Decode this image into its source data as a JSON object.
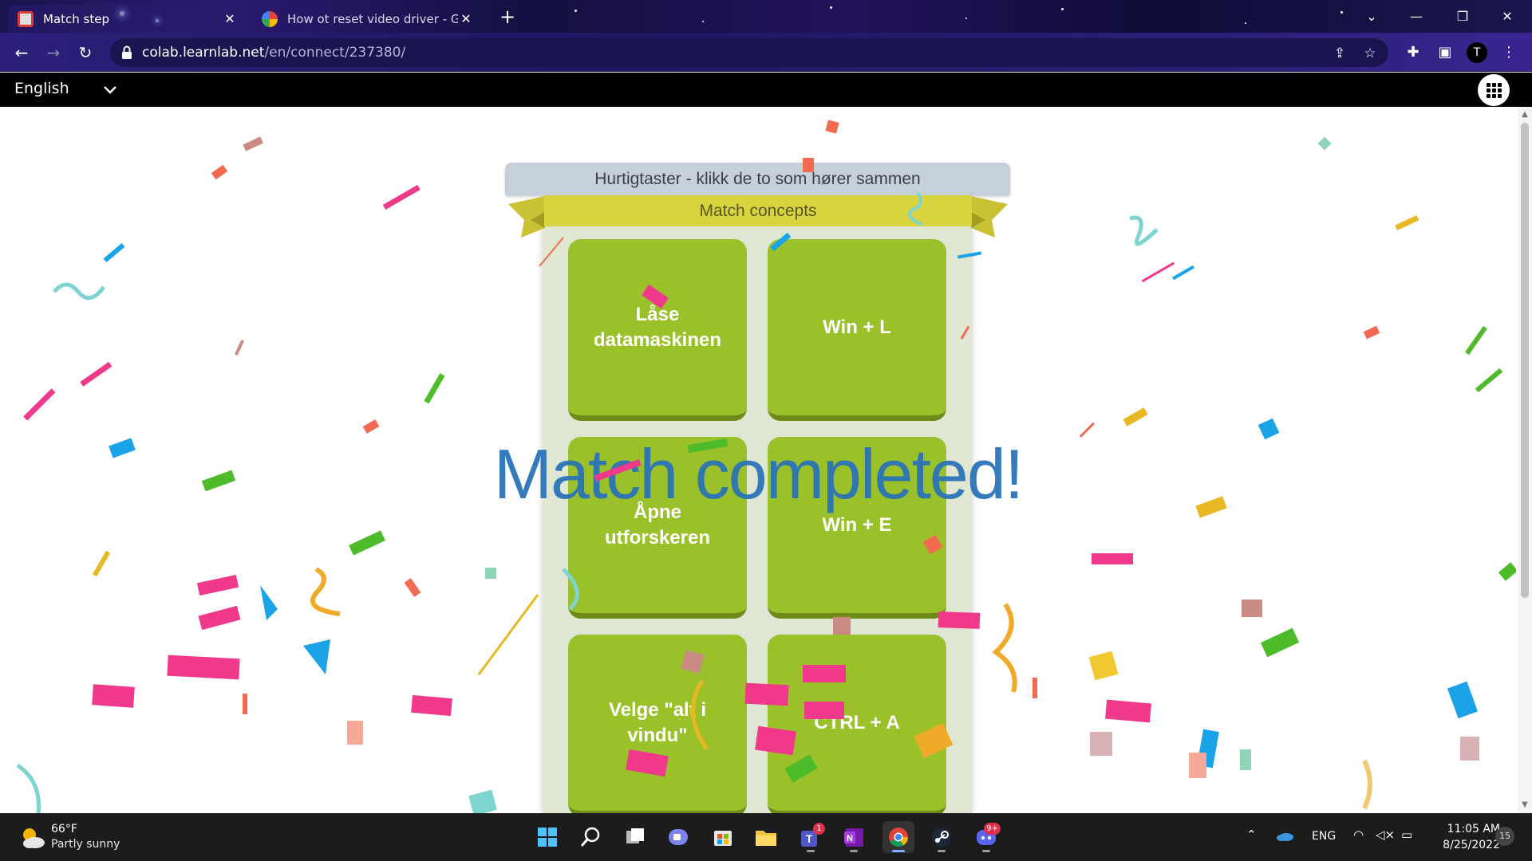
{
  "browser": {
    "tabs": [
      {
        "title": "Match step",
        "active": true,
        "favicon": "learnlab-icon"
      },
      {
        "title": "How ot reset video driver - Goog",
        "active": false,
        "favicon": "google-icon"
      }
    ],
    "new_tab_label": "+",
    "address": {
      "host": "colab.learnlab.net",
      "path": "/en/connect/237380/"
    }
  },
  "site": {
    "language": "English",
    "header_title": "Hurtigtaster - klikk de to som hører sammen",
    "ribbon_title": "Match concepts",
    "cards": [
      {
        "text": "Låse datamaskinen"
      },
      {
        "text": "Win + L"
      },
      {
        "text": "Åpne utforskeren"
      },
      {
        "text": "Win + E"
      },
      {
        "text": "Velge \"alt i vindu\""
      },
      {
        "text": "CTRL + A"
      }
    ],
    "completion_message": "Match completed!"
  },
  "taskbar": {
    "weather": {
      "temp": "66°F",
      "desc": "Partly sunny"
    },
    "language": "ENG",
    "time": "11:05 AM",
    "date": "8/25/2022",
    "notification_count": "15",
    "teams_badge": "1",
    "discord_badge": "9+"
  },
  "colors": {
    "card_green": "#9bc12a",
    "ribbon_yellow": "#d9d43e",
    "banner_blue": "#2b74b8",
    "header_grey": "#c6d0dc"
  }
}
